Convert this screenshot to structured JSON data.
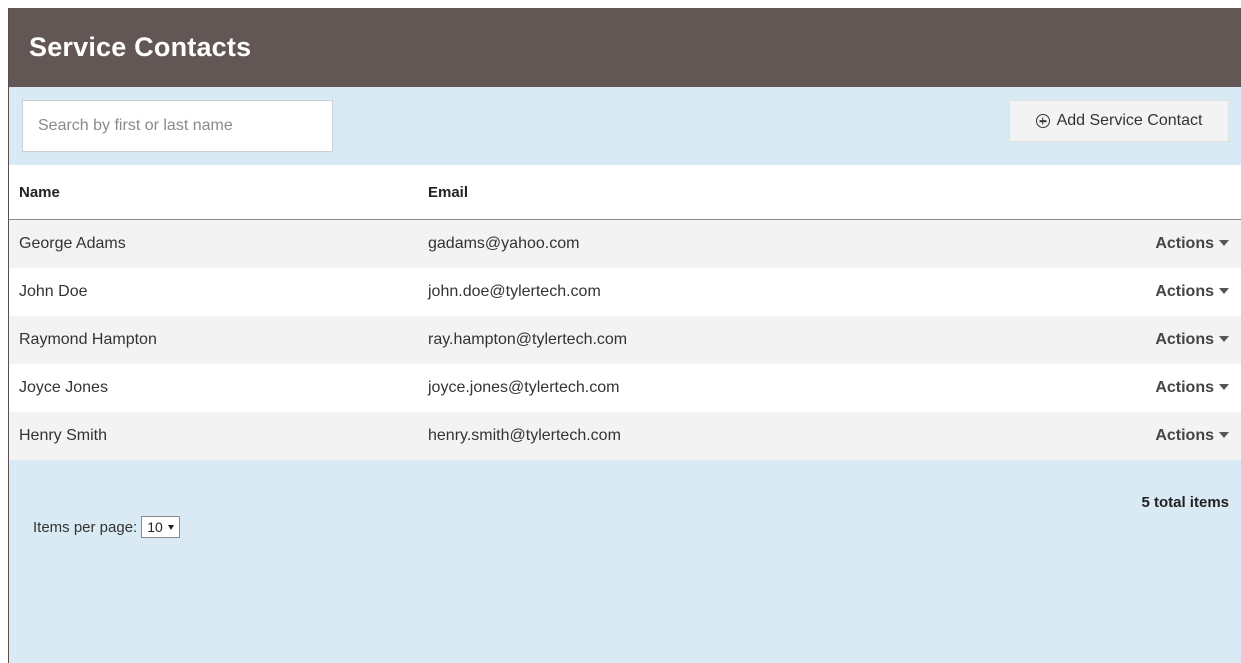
{
  "header": {
    "title": "Service Contacts"
  },
  "toolbar": {
    "search_placeholder": "Search by first or last name",
    "search_value": "",
    "add_button_label": "Add Service Contact",
    "add_button_icon": "plus-circle-icon"
  },
  "table": {
    "columns": {
      "name": "Name",
      "email": "Email"
    },
    "rows": [
      {
        "name": "George Adams",
        "email": "gadams@yahoo.com",
        "actions_label": "Actions"
      },
      {
        "name": "John Doe",
        "email": "john.doe@tylertech.com",
        "actions_label": "Actions"
      },
      {
        "name": "Raymond Hampton",
        "email": "ray.hampton@tylertech.com",
        "actions_label": "Actions"
      },
      {
        "name": "Joyce Jones",
        "email": "joyce.jones@tylertech.com",
        "actions_label": "Actions"
      },
      {
        "name": "Henry Smith",
        "email": "henry.smith@tylertech.com",
        "actions_label": "Actions"
      }
    ]
  },
  "footer": {
    "total_items": "5 total items",
    "items_per_page_label": "Items per page:",
    "items_per_page_value": "10"
  },
  "colors": {
    "header_bg": "#635755",
    "panel_bg": "#d9eaf5",
    "row_alt_bg": "#f3f3f3"
  }
}
